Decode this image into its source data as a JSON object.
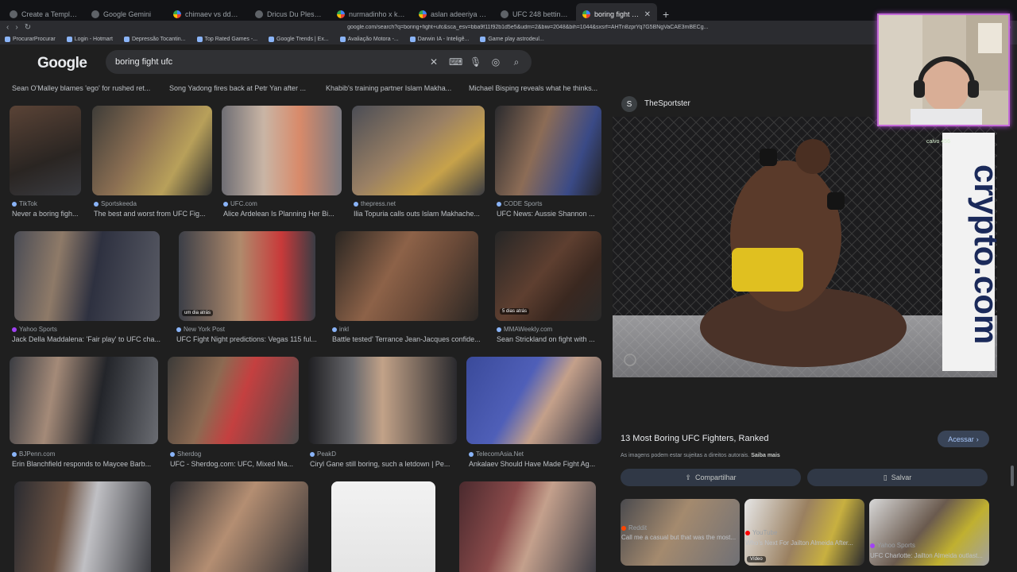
{
  "browser": {
    "tabs": [
      {
        "label": "Create a Template - TierMaker",
        "active": false
      },
      {
        "label": "Google Gemini",
        "active": false
      },
      {
        "label": "chimaev vs ddp - Pesquisa Google",
        "active": false
      },
      {
        "label": "Dricus Du Plessis e Khamzat Chimaev",
        "active": false
      },
      {
        "label": "nurmadinho x kuniev - Pesquisa Goo",
        "active": false
      },
      {
        "label": "aslan adeeriya x jose romero - Pesq",
        "active": false
      },
      {
        "label": "UFC 248 betting breakdown: Israel A",
        "active": false
      },
      {
        "label": "boring fight ufc - Pesquisa Goog",
        "active": true
      }
    ],
    "new_tab_label": "+",
    "url": "google.com/search?q=boring+fight+ufc&sca_esv=bba9f11f92b1d5e5&udm=2&biw=2048&bih=1044&sxsrf=AHTn8zprYq7G5BNgVaCAE3mBECg...",
    "bookmarks": [
      "ProcurarProcurar",
      "Login - Hotmart",
      "Depressão Tocantin...",
      "Top Rated Games -...",
      "Google Trends | Ex...",
      "Avaliação Motora -...",
      "Darwin IA - Inteligê...",
      "Game play astrodeul..."
    ]
  },
  "search": {
    "logo": "Google",
    "query": "boring fight ufc"
  },
  "top_captions": [
    "Sean O'Malley blames 'ego' for rushed ret...",
    "Song Yadong fires back at Petr Yan after ...",
    "Khabib's training partner Islam Makha...",
    "Michael Bisping reveals what he thinks..."
  ],
  "rows": [
    [
      {
        "source": "TikTok",
        "title": "Never a boring figh..."
      },
      {
        "source": "Sportskeeda",
        "title": "The best and worst from UFC Fig..."
      },
      {
        "source": "UFC.com",
        "title": "Alice Ardelean Is Planning Her Bi..."
      },
      {
        "source": "thepress.net",
        "title": "Ilia Topuria calls outs Islam Makhache..."
      },
      {
        "source": "CODE Sports",
        "title": "UFC News: Aussie Shannon ..."
      }
    ],
    [
      {
        "source": "Yahoo Sports",
        "title": "Jack Della Maddalena: 'Fair play' to UFC cha..."
      },
      {
        "source": "New York Post",
        "title": "UFC Fight Night predictions: Vegas 115 ful...",
        "badge": "um dia atrás"
      },
      {
        "source": "inkl",
        "title": "Battle tested' Terrance Jean-Jacques confide..."
      },
      {
        "source": "MMAWeekly.com",
        "title": "Sean Strickland on fight with ...",
        "badge": "5 dias atrás"
      }
    ],
    [
      {
        "source": "BJPenn.com",
        "title": "Erin Blanchfield responds to Maycee Barb..."
      },
      {
        "source": "Sherdog",
        "title": "UFC - Sherdog.com: UFC, Mixed Ma..."
      },
      {
        "source": "PeakD",
        "title": "Ciryl Gane still boring, such a letdown | Pe..."
      },
      {
        "source": "TelecomAsia.Net",
        "title": "Ankalaev Should Have Made Fight Ag..."
      }
    ]
  ],
  "panel": {
    "source": "TheSportster",
    "title": "13 Most Boring UFC Fighters, Ranked",
    "note": "As imagens podem estar sujeitas a direitos autorais.",
    "note_link": "Saiba mais",
    "visit_label": "Acessar",
    "share_label": "Compartilhar",
    "save_label": "Salvar",
    "image_text": "crypto.com",
    "related": [
      {
        "source": "Reddit",
        "title": "Call me a casual but that was the most..."
      },
      {
        "source": "YouTube",
        "title": "Who's Next For Jailton Almeida After...",
        "badge": "Vídeo"
      },
      {
        "source": "Yahoo Sports",
        "title": "UFC Charlotte: Jailton Almeida outlast..."
      }
    ]
  },
  "webcam": {
    "overlay": "calvo 456"
  },
  "colors": {
    "page_bg": "#1f1f1f",
    "accent_blue": "#8ab4f8",
    "webcam_border": "#c46bd8"
  }
}
